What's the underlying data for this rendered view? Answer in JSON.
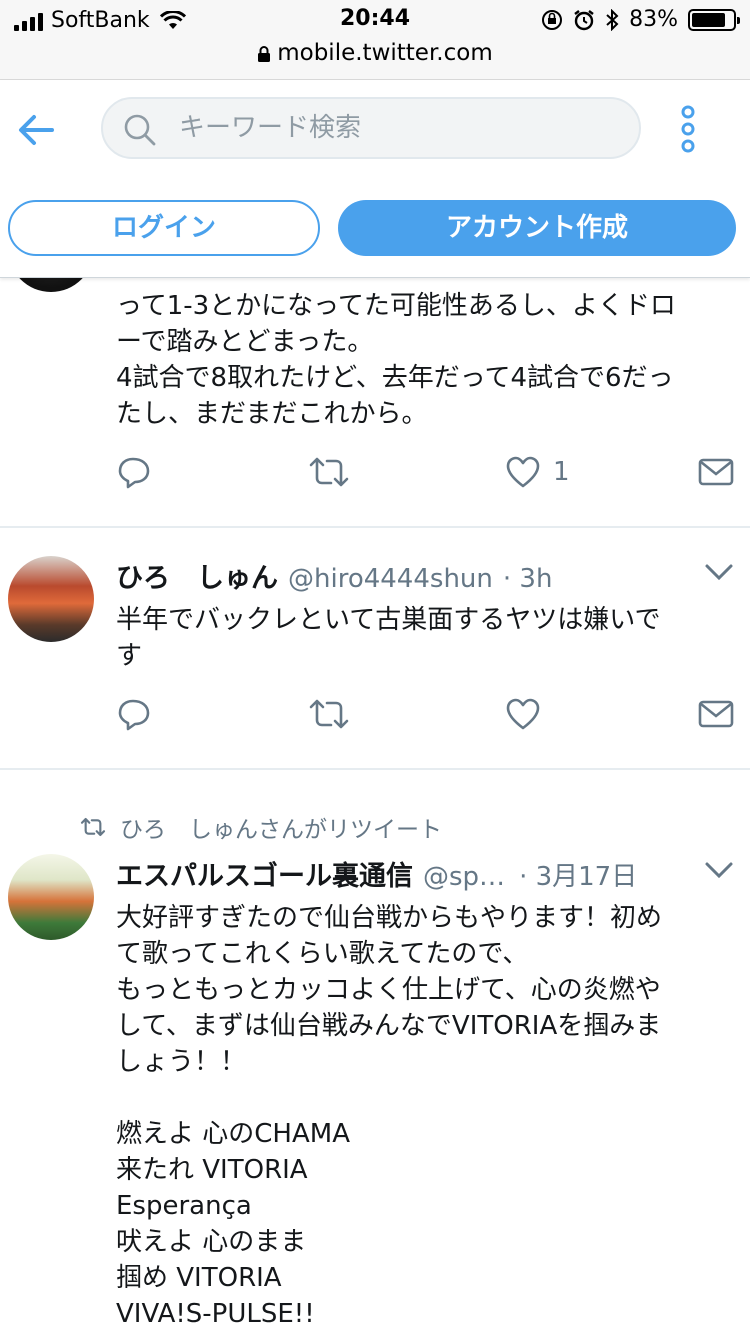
{
  "status_bar": {
    "carrier": "SoftBank",
    "time": "20:44",
    "battery_text": "83%",
    "battery_level": 0.83,
    "url": "mobile.twitter.com"
  },
  "header": {
    "search_placeholder": "キーワード検索",
    "login_label": "ログイン",
    "signup_label": "アカウント作成"
  },
  "colors": {
    "accent": "#4aa1ec",
    "muted": "#657786",
    "divider": "#e6ecf0"
  },
  "tweets": [
    {
      "text": "って1-3とかになってた可能性あるし、よくドロ\nーで踏みとどまった。\n4試合で8取れたけど、去年だって4試合で6だっ\nたし、まだまだこれから。",
      "like_count": "1"
    },
    {
      "name": "ひろ　しゅん",
      "handle": "@hiro4444shun",
      "time": "· 3h",
      "text": "半年でバックレといて古巣面するヤツは嫌いで\nす"
    },
    {
      "retweet_label": "ひろ　しゅんさんがリツイート",
      "name": "エスパルスゴール裏通信",
      "handle": "@sp…",
      "time": "· 3月17日",
      "text": "大好評すぎたので仙台戦からもやります！初め\nて歌ってこれくらい歌えてたので、\nもっともっとカッコよく仕上げて、心の炎燃や\nして、まずは仙台戦みんなでVITORIAを掴みま\nしょう！！\n\n燃えよ 心のCHAMA\n来たれ VITORIA\nEsperança\n吠えよ 心のまま\n掴め VITORIA\nVIVA!S-PULSE!!"
    }
  ],
  "icons": [
    "back-arrow-icon",
    "search-icon",
    "more-icon",
    "reply-icon",
    "retweet-icon",
    "like-icon",
    "dm-icon",
    "chevron-down-icon"
  ]
}
